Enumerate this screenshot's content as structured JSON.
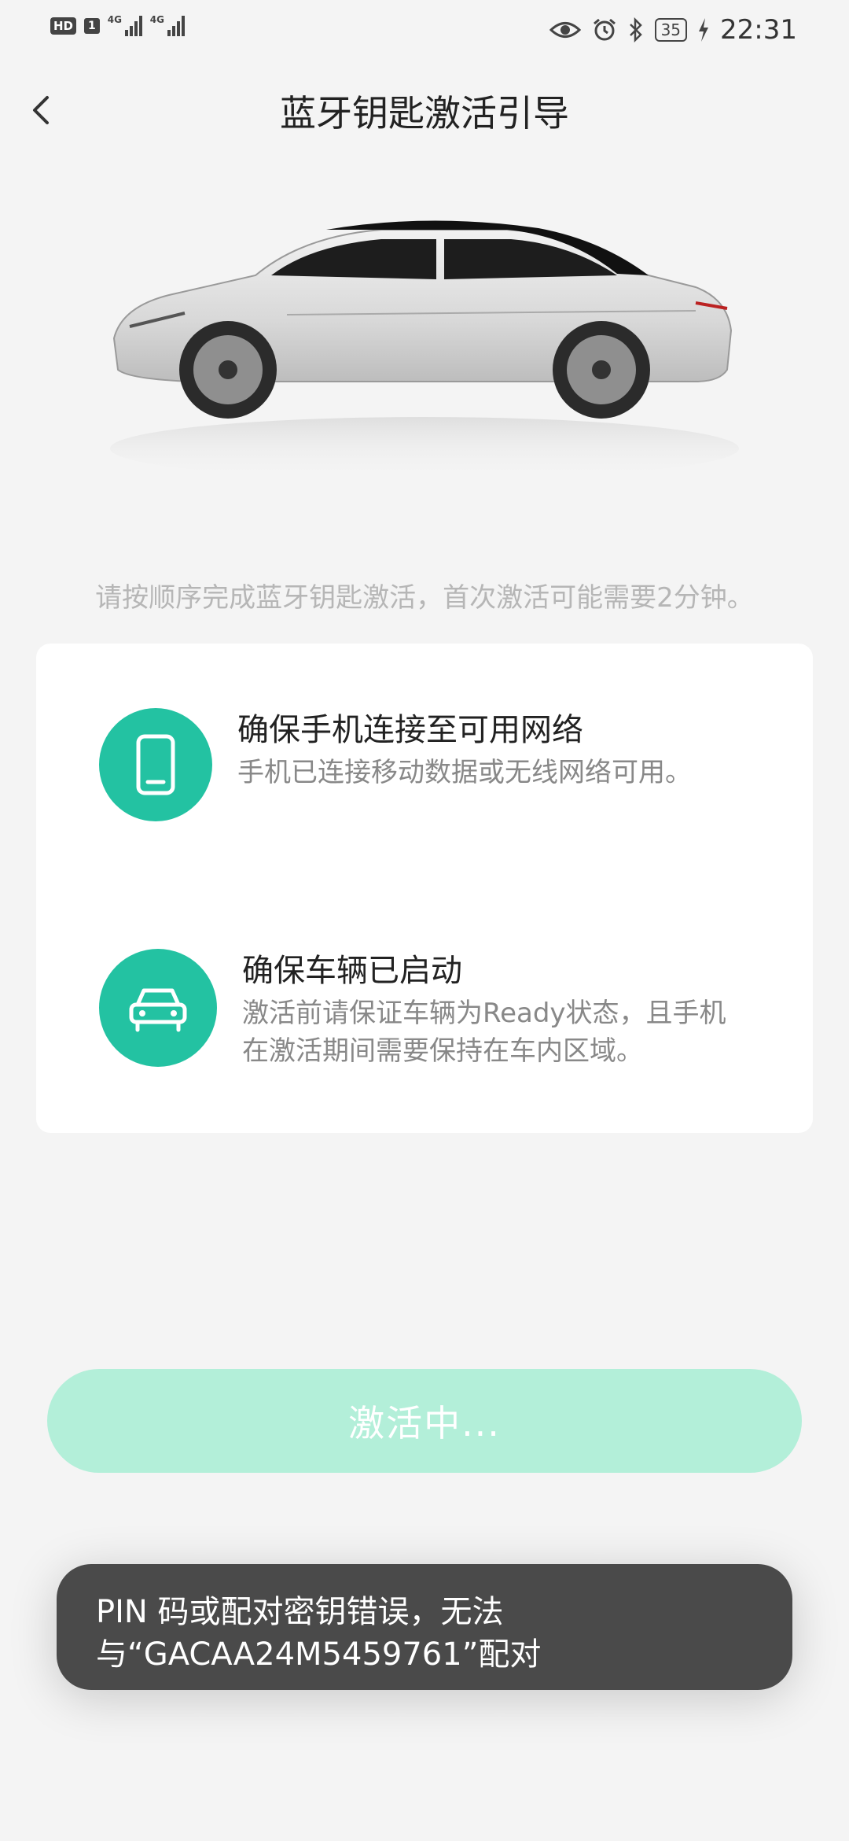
{
  "status_bar": {
    "hd": "HD",
    "sim": "1",
    "net1": "4G",
    "net2": "4G",
    "battery": "35",
    "time": "22:31"
  },
  "header": {
    "title": "蓝牙钥匙激活引导"
  },
  "hint": "请按顺序完成蓝牙钥匙激活，首次激活可能需要2分钟。",
  "steps": [
    {
      "icon": "phone-icon",
      "title": "确保手机连接至可用网络",
      "desc": "手机已连接移动数据或无线网络可用。"
    },
    {
      "icon": "car-icon",
      "title": "确保车辆已启动",
      "desc": "激活前请保证车辆为Ready状态，且手机\n在激活期间需要保持在车内区域。"
    }
  ],
  "activate_button": {
    "label": "激活中..."
  },
  "toast": {
    "line1": "PIN 码或配对密钥错误，无法",
    "line2": "与“GACAA24M5459761”配对"
  },
  "colors": {
    "accent": "#23c2a2",
    "button_bg": "#b3efd9",
    "toast_bg": "#4a4a4a"
  }
}
